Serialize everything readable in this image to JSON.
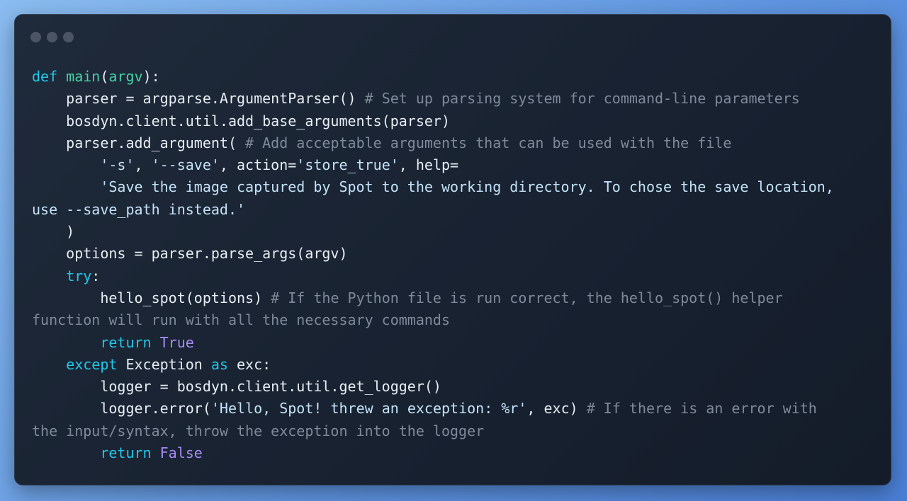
{
  "window": {
    "controls": [
      "dot",
      "dot",
      "dot"
    ]
  },
  "code_lines": [
    [
      [
        "kw",
        "def "
      ],
      [
        "fn",
        "main"
      ],
      [
        "plain",
        "("
      ],
      [
        "param",
        "argv"
      ],
      [
        "plain",
        "):"
      ]
    ],
    [
      [
        "plain",
        "    parser = argparse.ArgumentParser() "
      ],
      [
        "comment",
        "# Set up parsing system for command-line parameters"
      ]
    ],
    [
      [
        "plain",
        "    bosdyn.client.util.add_base_arguments(parser)"
      ]
    ],
    [
      [
        "plain",
        "    parser.add_argument( "
      ],
      [
        "comment",
        "# Add acceptable arguments that can be used with the file"
      ]
    ],
    [
      [
        "plain",
        "        "
      ],
      [
        "str",
        "'-s'"
      ],
      [
        "plain",
        ", "
      ],
      [
        "str",
        "'--save'"
      ],
      [
        "plain",
        ", action="
      ],
      [
        "str",
        "'store_true'"
      ],
      [
        "plain",
        ", help="
      ]
    ],
    [
      [
        "plain",
        "        "
      ],
      [
        "str",
        "'Save the image captured by Spot to the working directory. To chose the save location,"
      ]
    ],
    [
      [
        "str",
        "use --save_path instead.'"
      ]
    ],
    [
      [
        "plain",
        "    )"
      ]
    ],
    [
      [
        "plain",
        "    options = parser.parse_args(argv)"
      ]
    ],
    [
      [
        "plain",
        "    "
      ],
      [
        "kw",
        "try"
      ],
      [
        "plain",
        ":"
      ]
    ],
    [
      [
        "plain",
        "        hello_spot(options) "
      ],
      [
        "comment",
        "# If the Python file is run correct, the hello_spot() helper"
      ]
    ],
    [
      [
        "comment",
        "function will run with all the necessary commands"
      ]
    ],
    [
      [
        "plain",
        "        "
      ],
      [
        "kw",
        "return "
      ],
      [
        "bool",
        "True"
      ]
    ],
    [
      [
        "plain",
        "    "
      ],
      [
        "kw",
        "except "
      ],
      [
        "plain",
        "Exception "
      ],
      [
        "kw",
        "as "
      ],
      [
        "plain",
        "exc:"
      ]
    ],
    [
      [
        "plain",
        "        logger = bosdyn.client.util.get_logger()"
      ]
    ],
    [
      [
        "plain",
        "        logger.error("
      ],
      [
        "str",
        "'Hello, Spot! threw an exception: %r'"
      ],
      [
        "plain",
        ", exc) "
      ],
      [
        "comment",
        "# If there is an error with"
      ]
    ],
    [
      [
        "comment",
        "the input/syntax, throw the exception into the logger"
      ]
    ],
    [
      [
        "plain",
        "        "
      ],
      [
        "kw",
        "return "
      ],
      [
        "bool",
        "False"
      ]
    ]
  ],
  "colors": {
    "keyword": "#22c7e8",
    "function": "#45d4a6",
    "string": "#c4e2f7",
    "comment": "#7e8a99",
    "boolean": "#a88bf5",
    "plain": "#e6edf3"
  }
}
